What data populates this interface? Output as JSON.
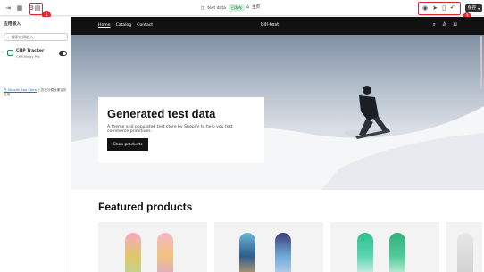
{
  "toolbar": {
    "theme_name": "test data",
    "status": "已发布",
    "default_label": "主页",
    "save_label": "保存"
  },
  "badges": {
    "b1": "1",
    "b2": "2",
    "b3": "3"
  },
  "sidebar": {
    "title": "应用嵌入",
    "search_placeholder": "搜索应用嵌入",
    "app": {
      "name": "CHP Tracker",
      "vendor": "CHP-Relay Pro"
    },
    "note_link": "在 Shopify App Store",
    "note_text": " 上查找与模板兼容的应用"
  },
  "store": {
    "nav": [
      "Home",
      "Catalog",
      "Contact"
    ],
    "name": "bill-test",
    "hero_title": "Generated test data",
    "hero_subtitle": "A theme and populated test store by Shopify to help you test commerce primitives.",
    "hero_button": "Shop products",
    "featured_title": "Featured products"
  },
  "icons": [
    "exit-icon",
    "sidebar-icon",
    "sections-icon",
    "apps-icon",
    "theme-icon",
    "globe-icon",
    "desktop-icon",
    "mobile-icon",
    "undo-icon",
    "more-icon",
    "search-icon",
    "account-icon",
    "cart-icon"
  ],
  "colors": {
    "highlight": "#e0282e",
    "accent": "#303030",
    "status_bg": "#d4f3dd"
  }
}
